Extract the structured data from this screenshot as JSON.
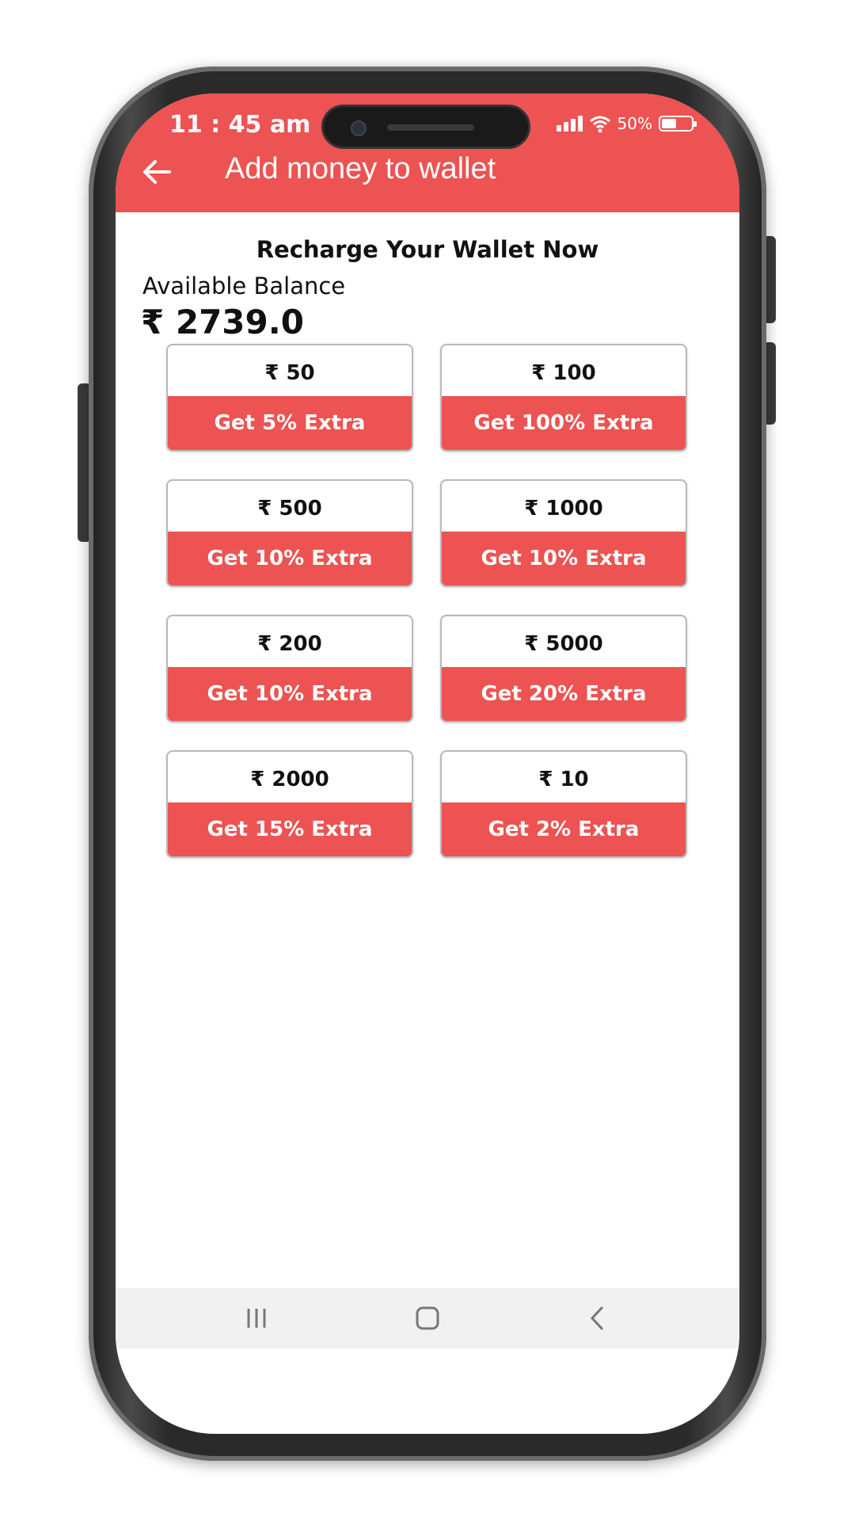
{
  "status": {
    "time": "11 : 45 am",
    "battery_text": "50%",
    "battery_level": 0.5
  },
  "header": {
    "title": "Add money to wallet",
    "back_icon": "back-arrow-icon"
  },
  "wallet": {
    "heading": "Recharge Your Wallet Now",
    "balance_label": "Available Balance",
    "balance_value": "₹ 2739.0"
  },
  "packs": [
    {
      "amount": "₹ 50",
      "offer": "Get 5% Extra"
    },
    {
      "amount": "₹ 100",
      "offer": "Get 100% Extra"
    },
    {
      "amount": "₹ 500",
      "offer": "Get 10% Extra"
    },
    {
      "amount": "₹ 1000",
      "offer": "Get 10% Extra"
    },
    {
      "amount": "₹ 200",
      "offer": "Get 10% Extra"
    },
    {
      "amount": "₹ 5000",
      "offer": "Get 20% Extra"
    },
    {
      "amount": "₹ 2000",
      "offer": "Get 15% Extra"
    },
    {
      "amount": "₹ 10",
      "offer": "Get 2% Extra"
    }
  ],
  "navbar": {
    "icons": [
      "recent-apps-icon",
      "home-icon",
      "back-icon"
    ]
  },
  "colors": {
    "accent": "#ec5352",
    "navbar": "#f1f1f1"
  }
}
